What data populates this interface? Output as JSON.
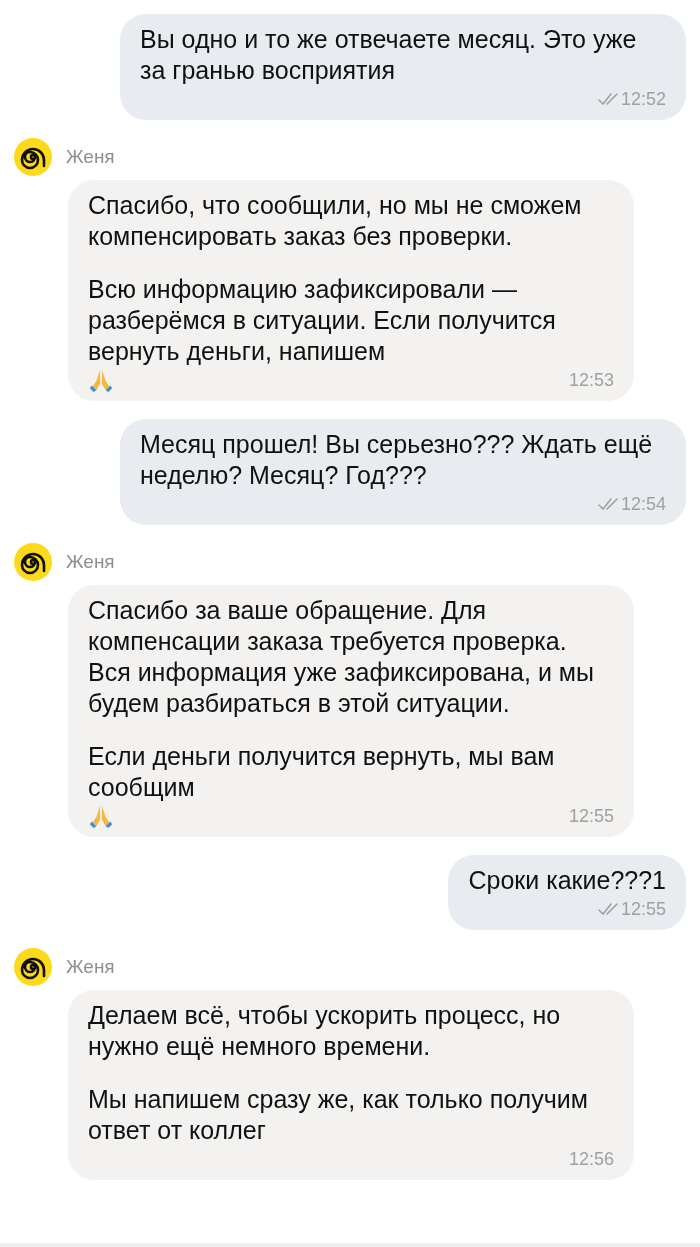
{
  "messages": [
    {
      "kind": "outgoing",
      "paragraphs": [
        "Вы одно и то же отвечаете месяц. Это уже за гранью восприятия"
      ],
      "time": "12:52",
      "read": true,
      "praying_emoji": false
    },
    {
      "kind": "incoming",
      "sender": "Женя",
      "paragraphs": [
        "Спасибо, что сообщили, но мы не сможем компенсировать заказ без проверки.",
        "Всю информацию зафиксировали — разберёмся в ситуации. Если получится вернуть деньги, напишем"
      ],
      "time": "12:53",
      "praying_emoji": true
    },
    {
      "kind": "outgoing",
      "paragraphs": [
        "Месяц прошел! Вы серьезно??? Ждать ещё неделю? Месяц? Год???"
      ],
      "time": "12:54",
      "read": true,
      "praying_emoji": false
    },
    {
      "kind": "incoming",
      "sender": "Женя",
      "paragraphs": [
        "Спасибо за ваше обращение. Для компенсации заказа требуется проверка. Вся информация уже зафиксирована, и мы будем разбираться в этой ситуации.",
        "Если деньги получится вернуть, мы вам сообщим"
      ],
      "time": "12:55",
      "praying_emoji": true
    },
    {
      "kind": "outgoing",
      "paragraphs": [
        "Сроки какие???1"
      ],
      "time": "12:55",
      "read": true,
      "praying_emoji": false
    },
    {
      "kind": "incoming",
      "sender": "Женя",
      "paragraphs": [
        "Делаем всё, чтобы ускорить процесс, но нужно ещё немного времени.",
        "Мы напишем сразу же, как только получим ответ от коллег"
      ],
      "time": "12:56",
      "praying_emoji": false
    }
  ]
}
